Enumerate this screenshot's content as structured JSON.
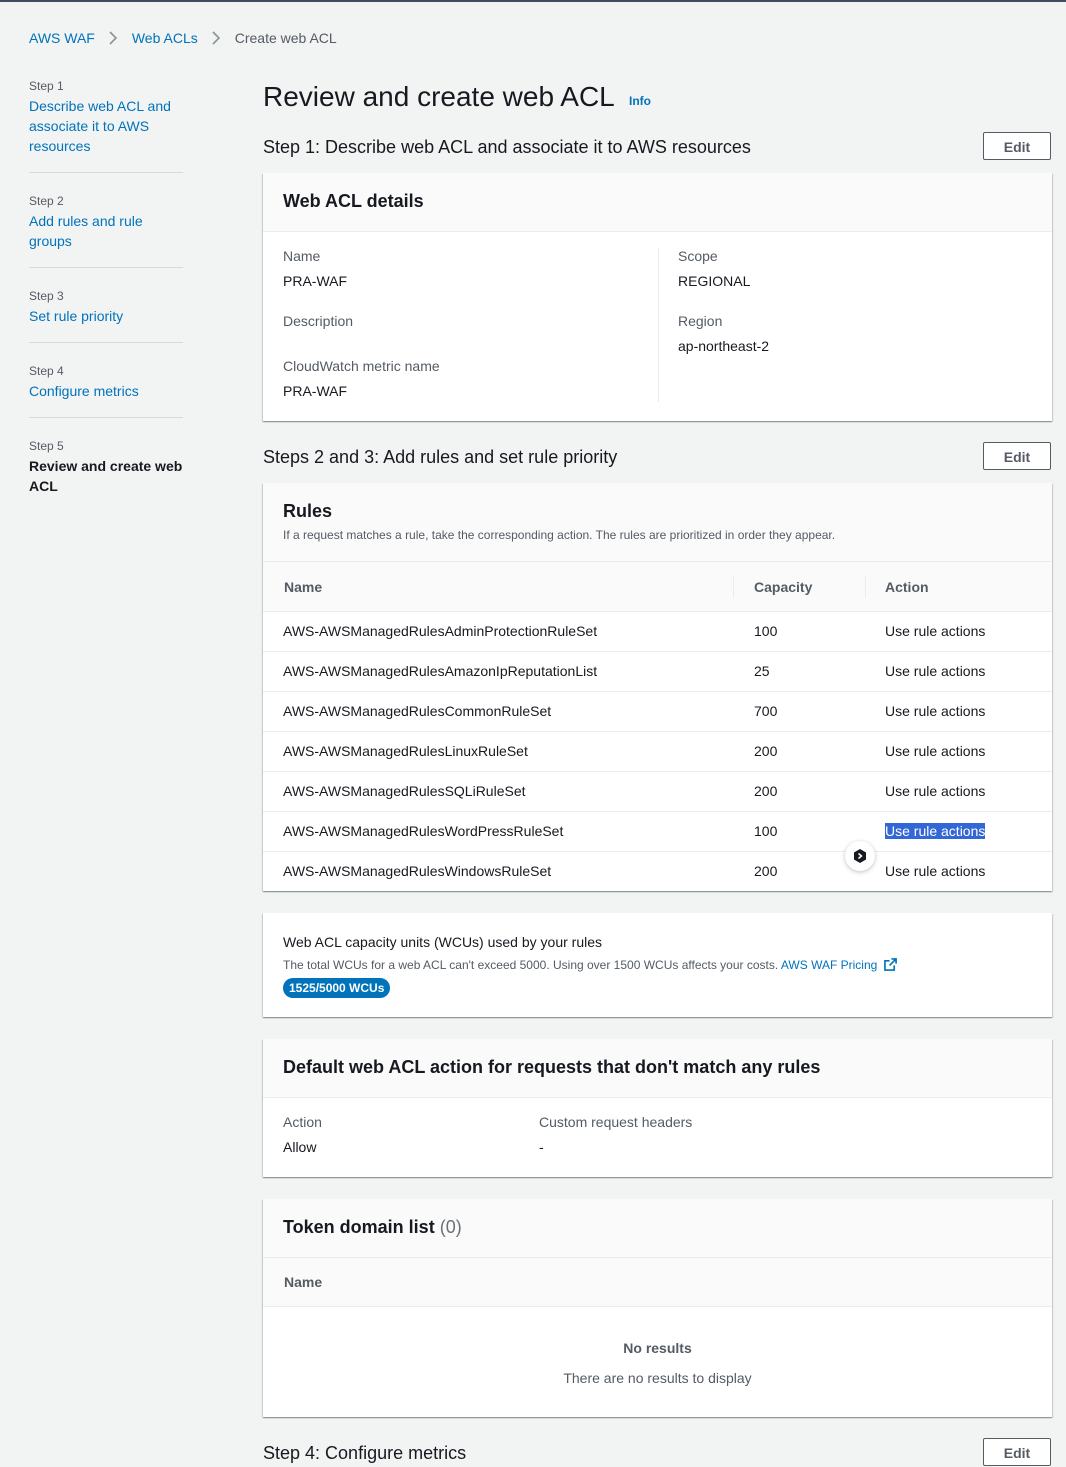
{
  "breadcrumb": {
    "items": [
      "AWS WAF",
      "Web ACLs"
    ],
    "current": "Create web ACL"
  },
  "steps": [
    {
      "num": "Step 1",
      "title": "Describe web ACL and associate it to AWS resources"
    },
    {
      "num": "Step 2",
      "title": "Add rules and rule groups"
    },
    {
      "num": "Step 3",
      "title": "Set rule priority"
    },
    {
      "num": "Step 4",
      "title": "Configure metrics"
    },
    {
      "num": "Step 5",
      "title": "Review and create web ACL"
    }
  ],
  "page": {
    "title": "Review and create web ACL",
    "info": "Info"
  },
  "edit_label": "Edit",
  "step1": {
    "heading": "Step 1: Describe web ACL and associate it to AWS resources",
    "panel_title": "Web ACL details",
    "name_label": "Name",
    "name_value": "PRA-WAF",
    "description_label": "Description",
    "metric_label": "CloudWatch metric name",
    "metric_value": "PRA-WAF",
    "scope_label": "Scope",
    "scope_value": "REGIONAL",
    "region_label": "Region",
    "region_value": "ap-northeast-2"
  },
  "rules_section": {
    "heading": "Steps 2 and 3: Add rules and set rule priority",
    "panel_title": "Rules",
    "description": "If a request matches a rule, take the corresponding action. The rules are prioritized in order they appear.",
    "columns": [
      "Name",
      "Capacity",
      "Action"
    ],
    "rows": [
      {
        "name": "AWS-AWSManagedRulesAdminProtectionRuleSet",
        "capacity": "100",
        "action": "Use rule actions"
      },
      {
        "name": "AWS-AWSManagedRulesAmazonIpReputationList",
        "capacity": "25",
        "action": "Use rule actions"
      },
      {
        "name": "AWS-AWSManagedRulesCommonRuleSet",
        "capacity": "700",
        "action": "Use rule actions"
      },
      {
        "name": "AWS-AWSManagedRulesLinuxRuleSet",
        "capacity": "200",
        "action": "Use rule actions"
      },
      {
        "name": "AWS-AWSManagedRulesSQLiRuleSet",
        "capacity": "200",
        "action": "Use rule actions"
      },
      {
        "name": "AWS-AWSManagedRulesWordPressRuleSet",
        "capacity": "100",
        "action": "Use rule actions"
      },
      {
        "name": "AWS-AWSManagedRulesWindowsRuleSet",
        "capacity": "200",
        "action": "Use rule actions"
      }
    ]
  },
  "wcu": {
    "title": "Web ACL capacity units (WCUs) used by your rules",
    "description": "The total WCUs for a web ACL can't exceed 5000. Using over 1500 WCUs affects your costs.",
    "pricing_link": "AWS WAF Pricing",
    "badge": "1525/5000 WCUs"
  },
  "default_action": {
    "title": "Default web ACL action for requests that don't match any rules",
    "action_label": "Action",
    "action_value": "Allow",
    "headers_label": "Custom request headers",
    "headers_value": "-"
  },
  "token_domain": {
    "title": "Token domain list",
    "count": "(0)",
    "column": "Name",
    "empty_title": "No results",
    "empty_text": "There are no results to display"
  },
  "step4": {
    "heading": "Step 4: Configure metrics"
  },
  "colors": {
    "link": "#0073bb",
    "badge": "#0073bb",
    "selection": "#3367d6"
  }
}
